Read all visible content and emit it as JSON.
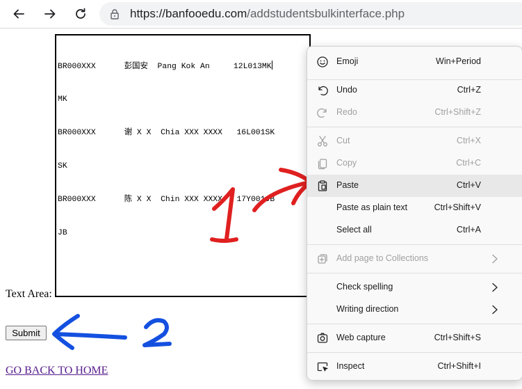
{
  "browser": {
    "url_host": "https://banfooedu.com",
    "url_path": "/addstudentsbulkinterface.php"
  },
  "page": {
    "textarea_lines": [
      "BR000XXX      彭国安  Pang Kok An     12L013MK",
      "MK",
      "BR000XXX      谢 X X  Chia XXX XXXX   16L001SK",
      "SK",
      "BR000XXX      陈 X X  Chin XXX XXXX   17Y001JB",
      "JB"
    ],
    "textarea_label": "Text Area:",
    "submit_label": "Submit",
    "home_link": "GO BACK TO HOME"
  },
  "annotations": {
    "step1": "1",
    "step2": "2",
    "step1_color": "#e02020",
    "step2_color": "#1450e0"
  },
  "context_menu": {
    "items": [
      {
        "label": "Emoji",
        "shortcut": "Win+Period",
        "icon": "emoji-icon"
      },
      {
        "label": "Undo",
        "shortcut": "Ctrl+Z",
        "icon": "undo-icon"
      },
      {
        "label": "Redo",
        "shortcut": "Ctrl+Shift+Z",
        "icon": "redo-icon"
      },
      {
        "label": "Cut",
        "shortcut": "Ctrl+X",
        "icon": "cut-icon"
      },
      {
        "label": "Copy",
        "shortcut": "Ctrl+C",
        "icon": "copy-icon"
      },
      {
        "label": "Paste",
        "shortcut": "Ctrl+V",
        "icon": "paste-icon"
      },
      {
        "label": "Paste as plain text",
        "shortcut": "Ctrl+Shift+V"
      },
      {
        "label": "Select all",
        "shortcut": "Ctrl+A"
      },
      {
        "label": "Add page to Collections",
        "icon": "collections-icon"
      },
      {
        "label": "Check spelling"
      },
      {
        "label": "Writing direction"
      },
      {
        "label": "Web capture",
        "shortcut": "Ctrl+Shift+S",
        "icon": "web-capture-icon"
      },
      {
        "label": "Inspect",
        "shortcut": "Ctrl+Shift+I",
        "icon": "inspect-icon"
      }
    ]
  }
}
